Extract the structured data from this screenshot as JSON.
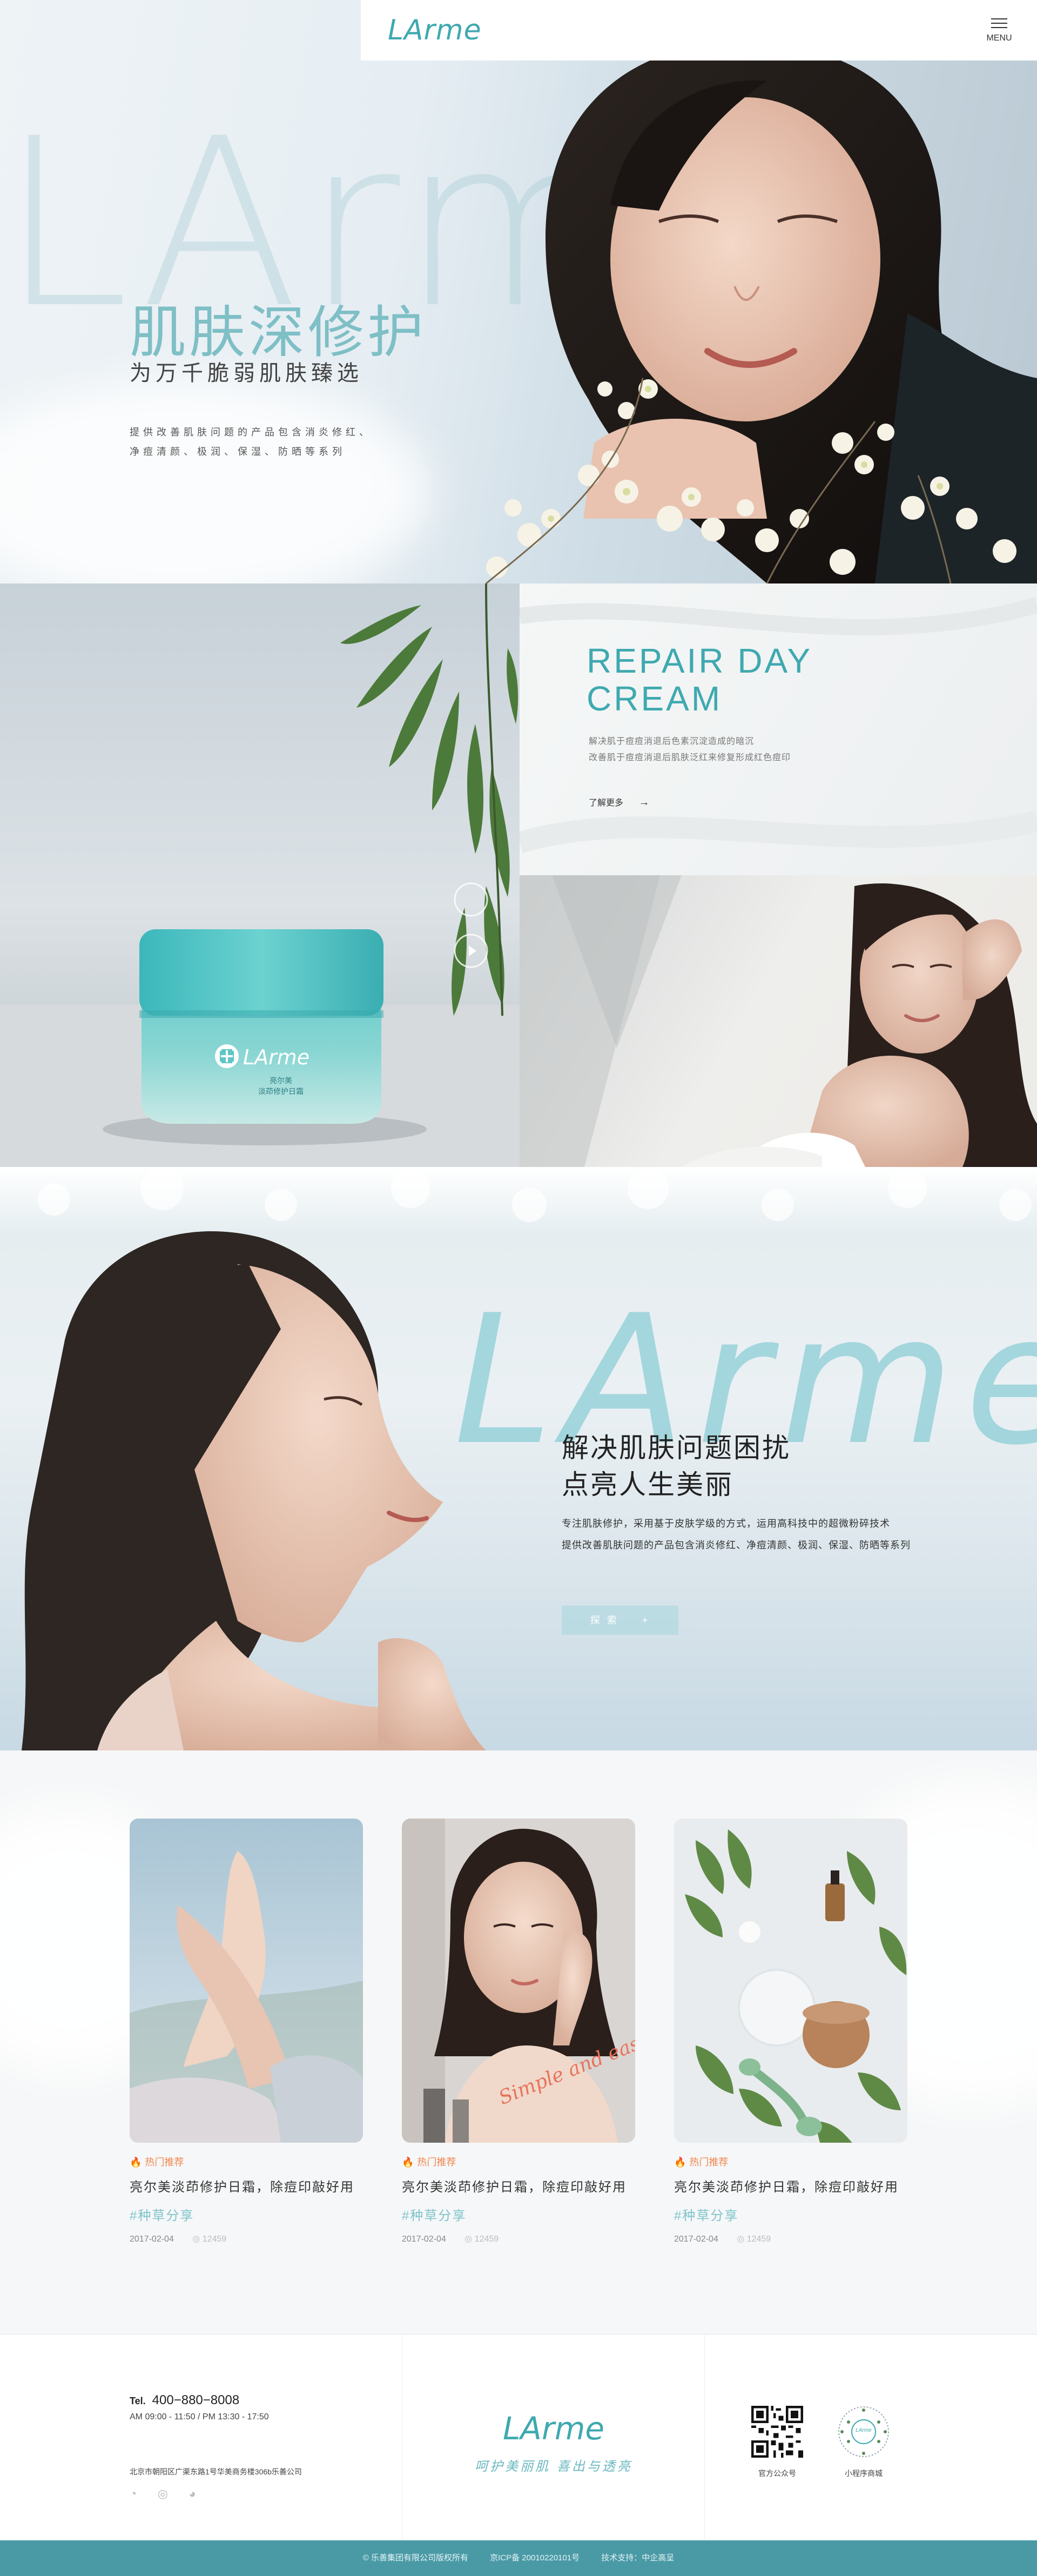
{
  "nav": {
    "logo": "LArme",
    "menu_label": "MENU"
  },
  "hero": {
    "watermark": "LArm",
    "title": "肌肤深修护",
    "subtitle": "为万千脆弱肌肤臻选",
    "desc_line1": "提供改善肌肤问题的产品包含消炎修红、",
    "desc_line2": "净痘清颜、极润、保湿、防晒等系列"
  },
  "product": {
    "jar_logo": "LArme",
    "jar_line1": "亮尔美",
    "jar_line2": "淡茚修护日霜",
    "repair_title_1": "REPAIR DAY",
    "repair_title_2": "CREAM",
    "repair_desc_1": "解决肌于痘痘消退后色素沉淀造成的暗沉",
    "repair_desc_2": "改善肌于痘痘消退后肌肤泛红来修复形成红色痘印",
    "learn_more": "了解更多",
    "arrow": "→"
  },
  "banner2": {
    "watermark": "LArme",
    "title_1": "解决肌肤问题困扰",
    "title_2": "点亮人生美丽",
    "desc_1": "专注肌肤修护，采用基于皮肤学级的方式，运用高科技中的超微粉碎技术",
    "desc_2": "提供改善肌肤问题的产品包含消炎修红、净痘清颜、极润、保湿、防晒等系列",
    "explore_label": "探 索",
    "explore_icon": "+"
  },
  "articles": [
    {
      "tag": "热门推荐",
      "title": "亮尔美淡茚修护日霜，除痘印敲好用",
      "hashtag": "#种草分享",
      "date": "2017-02-04",
      "views": "12459"
    },
    {
      "tag": "热门推荐",
      "title": "亮尔美淡茚修护日霜，除痘印敲好用",
      "hashtag": "#种草分享",
      "date": "2017-02-04",
      "views": "12459",
      "overlay_text": "Simple and easy!"
    },
    {
      "tag": "热门推荐",
      "title": "亮尔美淡茚修护日霜，除痘印敲好用",
      "hashtag": "#种草分享",
      "date": "2017-02-04",
      "views": "12459"
    }
  ],
  "footer": {
    "tel_label": "Tel.",
    "tel": "400−880−8008",
    "hours": "AM 09:00 - 11:50   /   PM 13:30 - 17:50",
    "address": "北京市朝阳区广渠东路1号华美商务楼306b乐善公司",
    "logo": "LArme",
    "slogan": "呵护美丽肌  喜出与透亮",
    "qr1_label": "官方公众号",
    "qr2_label": "小程序商城",
    "qr2_inner": "LArme",
    "social_icons": [
      "wechat-icon",
      "weibo-icon",
      "qq-icon"
    ]
  },
  "copyright": {
    "company": "© 乐善集团有限公司版权所有",
    "icp": "京ICP备 20010220101号",
    "support": "技术支持：中企高呈"
  },
  "colors": {
    "brand": "#3fa9b0",
    "accent_light": "#7fbfc6",
    "tag_orange": "#f0874e",
    "footer_bar": "#4a9aa6"
  }
}
